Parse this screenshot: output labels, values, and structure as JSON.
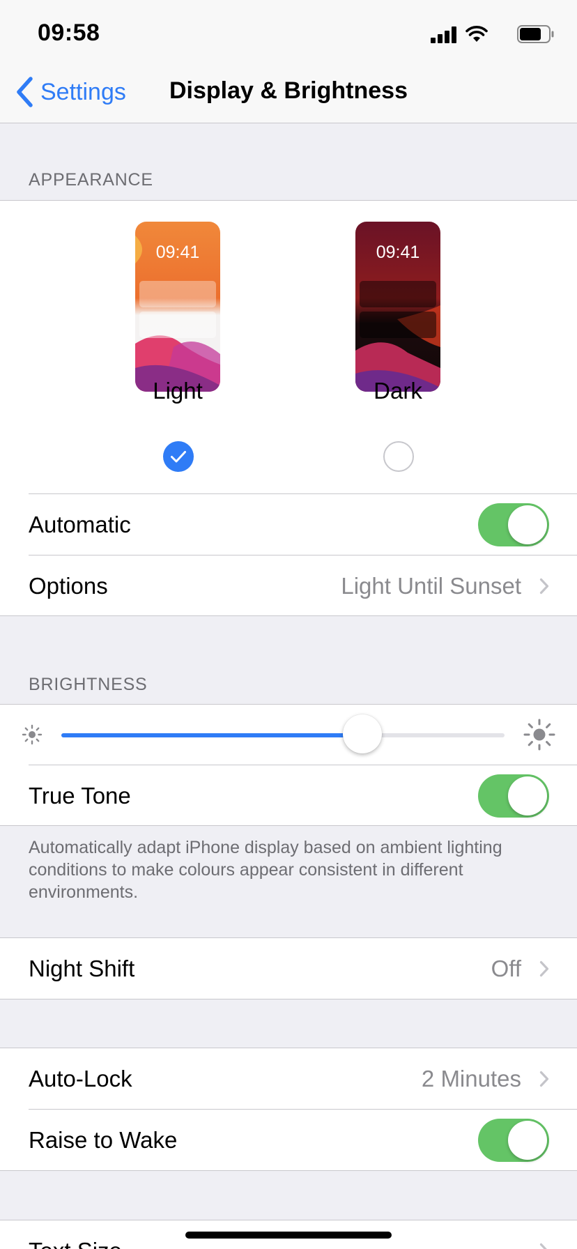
{
  "status_bar": {
    "time": "09:58"
  },
  "nav": {
    "back_label": "Settings",
    "title": "Display & Brightness"
  },
  "appearance": {
    "header": "APPEARANCE",
    "light": {
      "preview_time": "09:41",
      "label": "Light",
      "selected": true
    },
    "dark": {
      "preview_time": "09:41",
      "label": "Dark",
      "selected": false
    },
    "automatic": {
      "label": "Automatic",
      "on": true
    },
    "options": {
      "label": "Options",
      "value": "Light Until Sunset"
    }
  },
  "brightness": {
    "header": "BRIGHTNESS",
    "level": 0.68,
    "true_tone": {
      "label": "True Tone",
      "on": true
    },
    "footer": "Automatically adapt iPhone display based on ambient lighting conditions to make colours appear consistent in different environments."
  },
  "night_shift": {
    "label": "Night Shift",
    "value": "Off"
  },
  "lock": {
    "auto_lock": {
      "label": "Auto-Lock",
      "value": "2 Minutes"
    },
    "raise_to_wake": {
      "label": "Raise to Wake",
      "on": true
    }
  },
  "text_size": {
    "label": "Text Size"
  },
  "colors": {
    "accent": "#2f7cf6",
    "toggle_on": "#64c466",
    "secondary_text": "#8a8a8e",
    "background": "#efeff4"
  }
}
